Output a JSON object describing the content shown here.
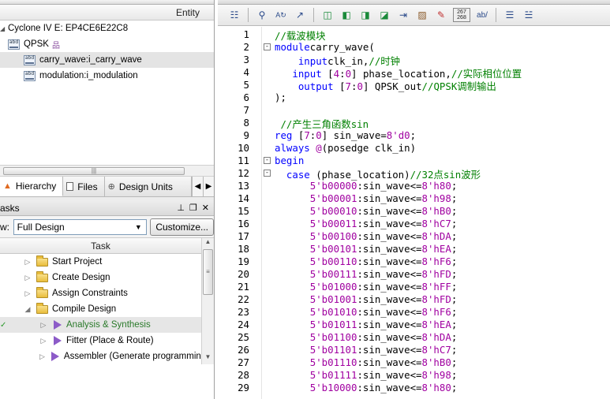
{
  "project_navigator": {
    "header_entity": "Entity",
    "device": "Cyclone IV E: EP4CE6E22C8",
    "items": [
      {
        "label": "QPSK",
        "level": 0
      },
      {
        "label": "carry_wave:i_carry_wave",
        "level": 1
      },
      {
        "label": "modulation:i_modulation",
        "level": 1
      }
    ],
    "tabs": [
      {
        "label": "Hierarchy"
      },
      {
        "label": "Files"
      },
      {
        "label": "Design Units"
      }
    ]
  },
  "tasks": {
    "title": "asks",
    "flow_label": "w:",
    "flow_value": "Full Design",
    "customize_button": "Customize...",
    "column_task": "Task",
    "items": [
      {
        "label": "Start Project",
        "icon": "folder-icon"
      },
      {
        "label": "Create Design",
        "icon": "folder-icon"
      },
      {
        "label": "Assign Constraints",
        "icon": "folder-icon"
      },
      {
        "label": "Compile Design",
        "icon": "folder-icon"
      },
      {
        "label": "Analysis & Synthesis",
        "icon": "play-icon"
      },
      {
        "label": "Fitter (Place & Route)",
        "icon": "play-icon"
      },
      {
        "label": "Assembler (Generate programming",
        "icon": "play-icon"
      }
    ]
  },
  "editor": {
    "line_numbers": [
      "1",
      "2",
      "3",
      "4",
      "5",
      "6",
      "7",
      "8",
      "9",
      "10",
      "11",
      "12",
      "13",
      "14",
      "15",
      "16",
      "17",
      "18",
      "19",
      "20",
      "21",
      "22",
      "23",
      "24",
      "25",
      "26",
      "27",
      "28",
      "29"
    ],
    "toolbar_badge": "267\n268",
    "lines": [
      [
        [
          "cm",
          "//载波模块"
        ]
      ],
      [
        [
          "kw",
          "module"
        ],
        [
          "",
          "carry_wave("
        ]
      ],
      [
        [
          "",
          "    "
        ],
        [
          "kw",
          "input"
        ],
        [
          "",
          "clk_in,"
        ],
        [
          "cm",
          "//时钟"
        ]
      ],
      [
        [
          "",
          "   "
        ],
        [
          "kw",
          "input"
        ],
        [
          "",
          " ["
        ],
        [
          "nm",
          "4"
        ],
        [
          "",
          ":"
        ],
        [
          "nm",
          "0"
        ],
        [
          "",
          "] phase_location,"
        ],
        [
          "cm",
          "//实际相位位置"
        ]
      ],
      [
        [
          "",
          "    "
        ],
        [
          "kw",
          "output"
        ],
        [
          "",
          " ["
        ],
        [
          "nm",
          "7"
        ],
        [
          "",
          ":"
        ],
        [
          "nm",
          "0"
        ],
        [
          "",
          "] QPSK_out"
        ],
        [
          "cm",
          "//QPSK调制输出"
        ]
      ],
      [
        [
          "",
          ");"
        ]
      ],
      [
        [
          "",
          ""
        ]
      ],
      [
        [
          "",
          ""
        ],
        [
          "cm",
          " //产生三角函数sin"
        ]
      ],
      [
        [
          "kw",
          "reg"
        ],
        [
          "",
          " ["
        ],
        [
          "nm",
          "7"
        ],
        [
          "",
          ":"
        ],
        [
          "nm",
          "0"
        ],
        [
          "",
          "] sin_wave="
        ],
        [
          "nm",
          "8'd0"
        ],
        [
          "",
          ";"
        ]
      ],
      [
        [
          "kw",
          "always"
        ],
        [
          "",
          " "
        ],
        [
          "op",
          "@"
        ],
        [
          "",
          "(posedge clk_in)"
        ]
      ],
      [
        [
          "kw",
          "begin"
        ]
      ],
      [
        [
          "",
          "  "
        ],
        [
          "kw",
          "case"
        ],
        [
          "",
          " (phase_location)"
        ],
        [
          "cm",
          "//32点sin波形"
        ]
      ],
      [
        [
          "",
          "      "
        ],
        [
          "nm",
          "5'b00000"
        ],
        [
          "",
          ":sin_wave<="
        ],
        [
          "nm",
          "8'h80"
        ],
        [
          "",
          ";"
        ]
      ],
      [
        [
          "",
          "      "
        ],
        [
          "nm",
          "5'b00001"
        ],
        [
          "",
          ":sin_wave<="
        ],
        [
          "nm",
          "8'h98"
        ],
        [
          "",
          ";"
        ]
      ],
      [
        [
          "",
          "      "
        ],
        [
          "nm",
          "5'b00010"
        ],
        [
          "",
          ":sin_wave<="
        ],
        [
          "nm",
          "8'hB0"
        ],
        [
          "",
          ";"
        ]
      ],
      [
        [
          "",
          "      "
        ],
        [
          "nm",
          "5'b00011"
        ],
        [
          "",
          ":sin_wave<="
        ],
        [
          "nm",
          "8'hC7"
        ],
        [
          "",
          ";"
        ]
      ],
      [
        [
          "",
          "      "
        ],
        [
          "nm",
          "5'b00100"
        ],
        [
          "",
          ":sin_wave<="
        ],
        [
          "nm",
          "8'hDA"
        ],
        [
          "",
          ";"
        ]
      ],
      [
        [
          "",
          "      "
        ],
        [
          "nm",
          "5'b00101"
        ],
        [
          "",
          ":sin_wave<="
        ],
        [
          "nm",
          "8'hEA"
        ],
        [
          "",
          ";"
        ]
      ],
      [
        [
          "",
          "      "
        ],
        [
          "nm",
          "5'b00110"
        ],
        [
          "",
          ":sin_wave<="
        ],
        [
          "nm",
          "8'hF6"
        ],
        [
          "",
          ";"
        ]
      ],
      [
        [
          "",
          "      "
        ],
        [
          "nm",
          "5'b00111"
        ],
        [
          "",
          ":sin_wave<="
        ],
        [
          "nm",
          "8'hFD"
        ],
        [
          "",
          ";"
        ]
      ],
      [
        [
          "",
          "      "
        ],
        [
          "nm",
          "5'b01000"
        ],
        [
          "",
          ":sin_wave<="
        ],
        [
          "nm",
          "8'hFF"
        ],
        [
          "",
          ";"
        ]
      ],
      [
        [
          "",
          "      "
        ],
        [
          "nm",
          "5'b01001"
        ],
        [
          "",
          ":sin_wave<="
        ],
        [
          "nm",
          "8'hFD"
        ],
        [
          "",
          ";"
        ]
      ],
      [
        [
          "",
          "      "
        ],
        [
          "nm",
          "5'b01010"
        ],
        [
          "",
          ":sin_wave<="
        ],
        [
          "nm",
          "8'hF6"
        ],
        [
          "",
          ";"
        ]
      ],
      [
        [
          "",
          "      "
        ],
        [
          "nm",
          "5'b01011"
        ],
        [
          "",
          ":sin_wave<="
        ],
        [
          "nm",
          "8'hEA"
        ],
        [
          "",
          ";"
        ]
      ],
      [
        [
          "",
          "      "
        ],
        [
          "nm",
          "5'b01100"
        ],
        [
          "",
          ":sin_wave<="
        ],
        [
          "nm",
          "8'hDA"
        ],
        [
          "",
          ";"
        ]
      ],
      [
        [
          "",
          "      "
        ],
        [
          "nm",
          "5'b01101"
        ],
        [
          "",
          ":sin_wave<="
        ],
        [
          "nm",
          "8'hC7"
        ],
        [
          "",
          ";"
        ]
      ],
      [
        [
          "",
          "      "
        ],
        [
          "nm",
          "5'b01110"
        ],
        [
          "",
          ":sin_wave<="
        ],
        [
          "nm",
          "8'hB0"
        ],
        [
          "",
          ";"
        ]
      ],
      [
        [
          "",
          "      "
        ],
        [
          "nm",
          "5'b01111"
        ],
        [
          "",
          ":sin_wave<="
        ],
        [
          "nm",
          "8'h98"
        ],
        [
          "",
          ";"
        ]
      ],
      [
        [
          "",
          "      "
        ],
        [
          "nm",
          "5'b10000"
        ],
        [
          "",
          ":sin_wave<="
        ],
        [
          "nm",
          "8'h80"
        ],
        [
          "",
          ";"
        ]
      ]
    ]
  }
}
